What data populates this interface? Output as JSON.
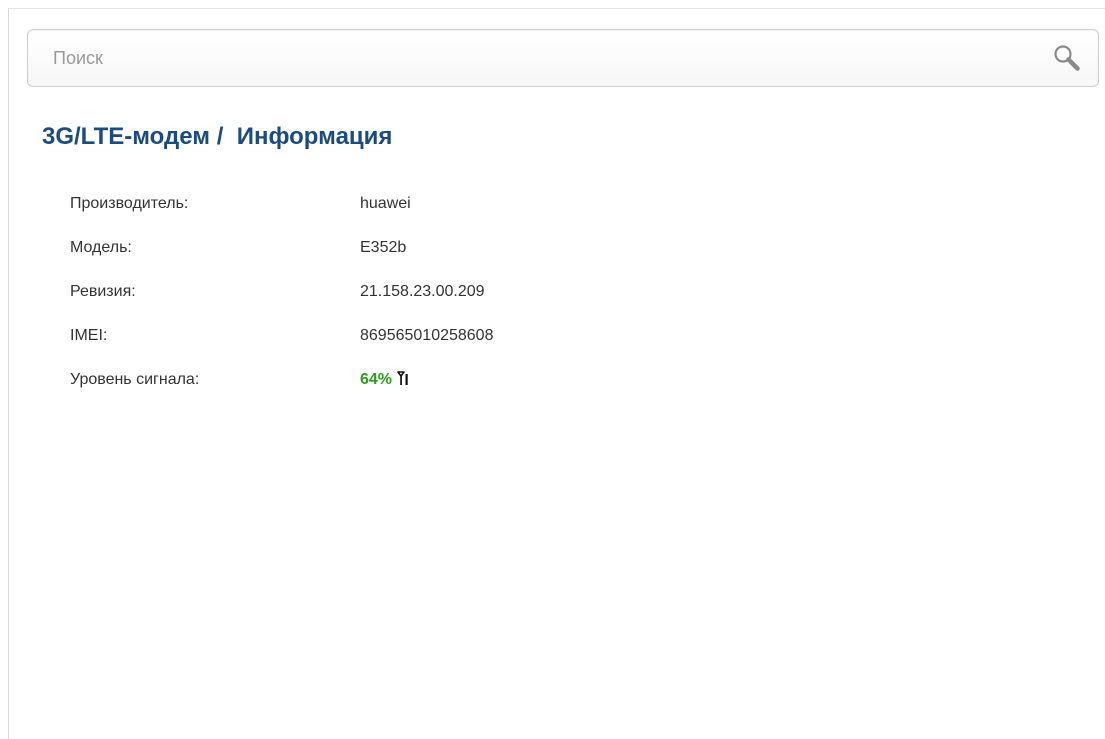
{
  "search": {
    "placeholder": "Поиск",
    "icon": "search-icon"
  },
  "page": {
    "title": "3G/LTE-модем /  Информация"
  },
  "info": {
    "rows": [
      {
        "label": "Производитель:",
        "value": "huawei"
      },
      {
        "label": "Модель:",
        "value": "E352b"
      },
      {
        "label": "Ревизия:",
        "value": "21.158.23.00.209"
      },
      {
        "label": "IMEI:",
        "value": "869565010258608"
      },
      {
        "label": "Уровень сигнала:",
        "value": "64%"
      }
    ],
    "signal_level_percent": 64,
    "signal_icon": "antenna-icon"
  },
  "colors": {
    "title": "#1c4c7d",
    "signal_good": "#2e9e1e",
    "text": "#333333"
  }
}
